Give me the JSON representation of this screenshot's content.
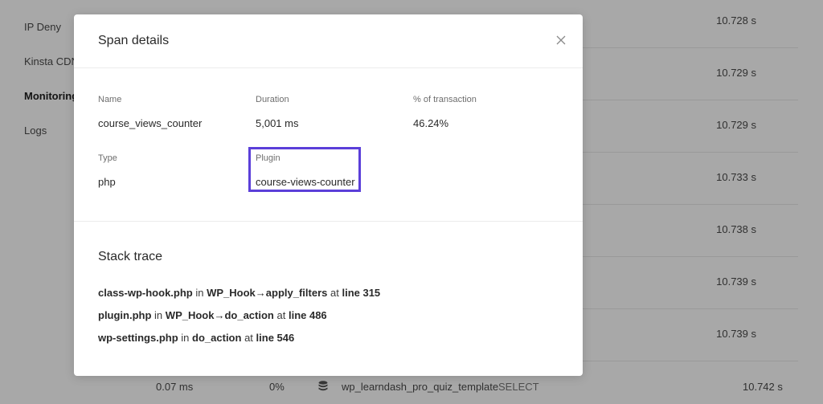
{
  "sidebar": {
    "items": [
      {
        "label": "IP Deny"
      },
      {
        "label": "Kinsta CDN"
      },
      {
        "label": "Monitoring"
      },
      {
        "label": "Logs"
      }
    ]
  },
  "background_table": {
    "durations": [
      "10.728 s",
      "10.729 s",
      "10.729 s",
      "10.733 s",
      "10.738 s",
      "10.739 s",
      "10.739 s"
    ],
    "last_row": {
      "time": "0.07 ms",
      "percent": "0%",
      "query_name": "wp_learndash_pro_quiz_template",
      "query_type": "SELECT",
      "duration": "10.742 s"
    }
  },
  "modal": {
    "title": "Span details",
    "close_icon": "close-icon",
    "fields": {
      "name": {
        "label": "Name",
        "value": "course_views_counter"
      },
      "duration": {
        "label": "Duration",
        "value": "5,001 ms"
      },
      "percent": {
        "label": "% of transaction",
        "value": "46.24%"
      },
      "type": {
        "label": "Type",
        "value": "php"
      },
      "plugin": {
        "label": "Plugin",
        "value": "course-views-counter"
      }
    },
    "highlight_color": "#5b3fd9",
    "stack_trace": {
      "title": "Stack trace",
      "lines": [
        {
          "file": "class-wp-hook.php",
          "in": "in",
          "function": "WP_Hook→apply_filters",
          "at": "at",
          "line": "line 315"
        },
        {
          "file": "plugin.php",
          "in": "in",
          "function": "WP_Hook→do_action",
          "at": "at",
          "line": "line 486"
        },
        {
          "file": "wp-settings.php",
          "in": "in",
          "function": "do_action",
          "at": "at",
          "line": "line 546"
        }
      ]
    }
  }
}
